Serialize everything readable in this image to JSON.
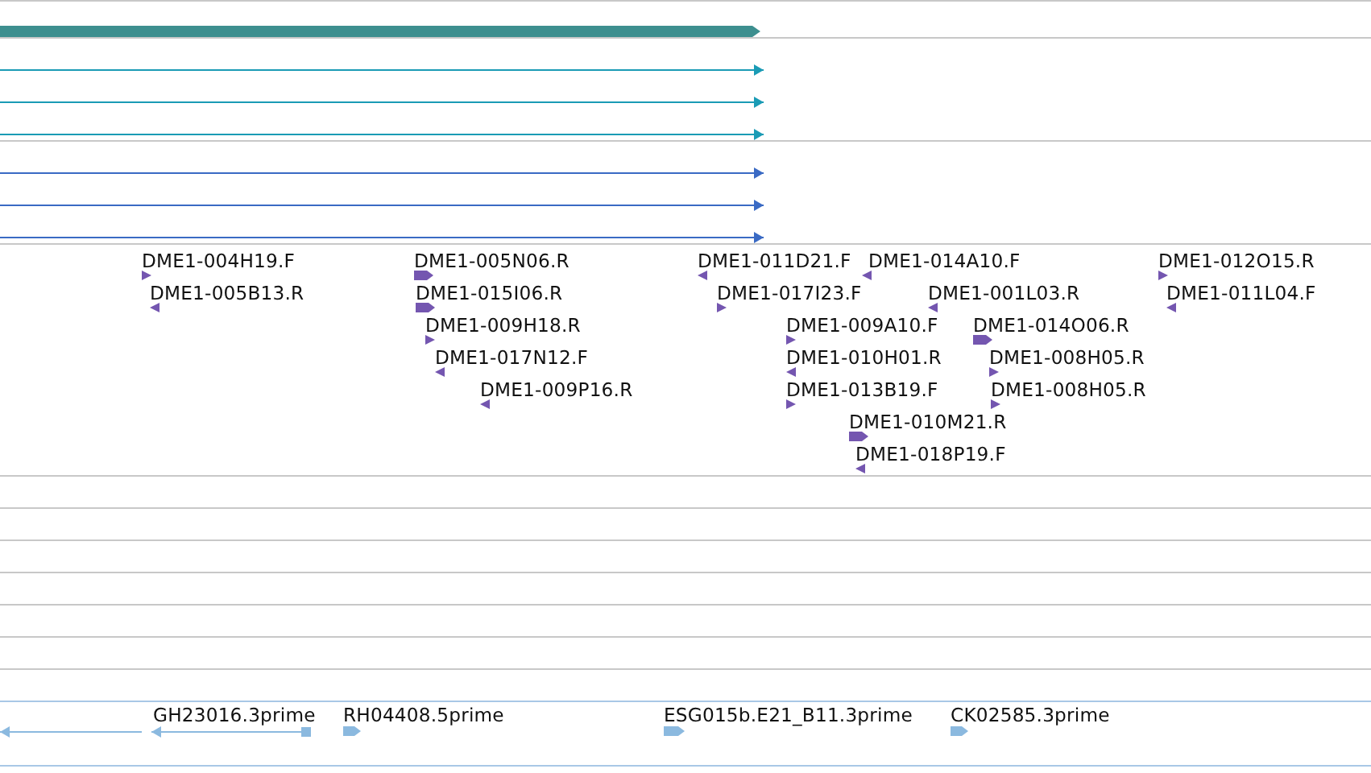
{
  "tracks": [
    {
      "color": "#3d8f8f",
      "features": [
        {
          "kind": "bar",
          "reverse": false
        }
      ]
    },
    {
      "color": "#1a9bb5",
      "features": [
        {
          "kind": "line",
          "reverse": false
        },
        {
          "kind": "line",
          "reverse": false
        },
        {
          "kind": "line",
          "reverse": false
        }
      ]
    },
    {
      "color": "#3a6ac4",
      "features": [
        {
          "kind": "line",
          "reverse": false
        },
        {
          "kind": "line",
          "reverse": false
        },
        {
          "kind": "line",
          "reverse": false
        }
      ]
    },
    {
      "color": "#7456b0",
      "features": [
        {
          "kind": "block",
          "label": "DME1-004H19.F",
          "reverse": false
        },
        {
          "kind": "block",
          "label": "DME1-005B13.R",
          "reverse": true
        },
        {
          "kind": "wide",
          "label": "DME1-005N06.R",
          "reverse": false
        },
        {
          "kind": "wide",
          "label": "DME1-015I06.R",
          "reverse": false
        },
        {
          "kind": "block",
          "label": "DME1-009H18.R",
          "reverse": false
        },
        {
          "kind": "block",
          "label": "DME1-017N12.F",
          "reverse": true
        },
        {
          "kind": "block",
          "label": "DME1-009P16.R",
          "reverse": true
        },
        {
          "kind": "block",
          "label": "DME1-011D21.F",
          "reverse": true
        },
        {
          "kind": "block",
          "label": "DME1-014A10.F",
          "reverse": true
        },
        {
          "kind": "block",
          "label": "DME1-017I23.F",
          "reverse": false
        },
        {
          "kind": "block",
          "label": "DME1-001L03.R",
          "reverse": true
        },
        {
          "kind": "block",
          "label": "DME1-012O15.R",
          "reverse": false
        },
        {
          "kind": "block",
          "label": "DME1-011L04.F",
          "reverse": true
        },
        {
          "kind": "block",
          "label": "DME1-009A10.F",
          "reverse": false
        },
        {
          "kind": "block",
          "label": "DME1-010H01.R",
          "reverse": true
        },
        {
          "kind": "block",
          "label": "DME1-013B19.F",
          "reverse": false
        },
        {
          "kind": "wide",
          "label": "DME1-014O06.R",
          "reverse": false
        },
        {
          "kind": "block",
          "label": "DME1-008H05.R",
          "reverse": false
        },
        {
          "kind": "block",
          "label": "DME1-008H05.R",
          "reverse": false
        },
        {
          "kind": "wide",
          "label": "DME1-010M21.R",
          "reverse": false
        },
        {
          "kind": "block",
          "label": "DME1-018P19.F",
          "reverse": true
        }
      ]
    },
    {
      "color": "#8bb9df",
      "features": [
        {
          "kind": "line",
          "reverse": true
        },
        {
          "kind": "line",
          "label": "GH23016.3prime",
          "reverse": true
        },
        {
          "kind": "wide",
          "label": "RH04408.5prime",
          "reverse": false
        },
        {
          "kind": "wide",
          "label": "ESG015b.E21_B11.3prime",
          "reverse": false
        },
        {
          "kind": "wide",
          "label": "CK02585.3prime",
          "reverse": false
        }
      ]
    }
  ]
}
